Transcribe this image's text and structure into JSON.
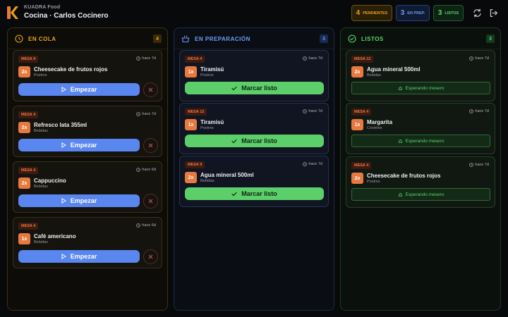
{
  "header": {
    "brand": "KUADRA Food",
    "station": "Cocina · Carlos Cocinero",
    "pills": {
      "queued": {
        "count": "4",
        "label": "pendientes"
      },
      "preparing": {
        "count": "3",
        "label": "en prep."
      },
      "ready": {
        "count": "3",
        "label": "listos"
      }
    },
    "icons": {
      "refresh": "refresh-icon",
      "logout": "logout-icon"
    }
  },
  "columns": {
    "queued": {
      "title": "En cola",
      "count": "4",
      "icon": "clock-icon",
      "cards": [
        {
          "table": "Mesa 9",
          "time": "hace 7d",
          "qty": "2x",
          "item": "Cheesecake de frutos rojos",
          "category": "Postres",
          "action": "Empezar"
        },
        {
          "table": "Mesa 4",
          "time": "hace 7d",
          "qty": "2x",
          "item": "Refresco lata 355ml",
          "category": "Bebidas",
          "action": "Empezar"
        },
        {
          "table": "Mesa 4",
          "time": "hace 6d",
          "qty": "2x",
          "item": "Cappuccino",
          "category": "Bebidas",
          "action": "Empezar"
        },
        {
          "table": "Mesa 4",
          "time": "hace 6d",
          "qty": "1x",
          "item": "Café americano",
          "category": "Bebidas",
          "action": "Empezar"
        }
      ]
    },
    "preparing": {
      "title": "En preparación",
      "count": "3",
      "icon": "cooking-pot-icon",
      "cards": [
        {
          "table": "Mesa 4",
          "time": "hace 7d",
          "qty": "1x",
          "item": "Tiramisú",
          "category": "Postres",
          "action": "Marcar listo"
        },
        {
          "table": "Mesa 12",
          "time": "hace 7d",
          "qty": "1x",
          "item": "Tiramisú",
          "category": "Postres",
          "action": "Marcar listo"
        },
        {
          "table": "Mesa 9",
          "time": "hace 7d",
          "qty": "2x",
          "item": "Agua mineral 500ml",
          "category": "Bebidas",
          "action": "Marcar listo"
        }
      ]
    },
    "ready": {
      "title": "Listos",
      "count": "3",
      "icon": "check-circle-icon",
      "cards": [
        {
          "table": "Mesa 12",
          "time": "hace 7d",
          "qty": "2x",
          "item": "Agua mineral 500ml",
          "category": "Bebidas",
          "status": "Esperando mesero"
        },
        {
          "table": "Mesa 4",
          "time": "hace 7d",
          "qty": "1x",
          "item": "Margarita",
          "category": "Cocteles",
          "status": "Esperando mesero"
        },
        {
          "table": "Mesa 4",
          "time": "hace 7d",
          "qty": "2x",
          "item": "Cheesecake de frutos rojos",
          "category": "Postres",
          "status": "Esperando mesero"
        }
      ]
    }
  },
  "colors": {
    "queued": "#e8a317",
    "preparing": "#6f9bf5",
    "ready": "#5bd46c",
    "start_button": "#5a86ef",
    "ready_button": "#5ccf6a",
    "qty_badge": "#e8793f"
  }
}
